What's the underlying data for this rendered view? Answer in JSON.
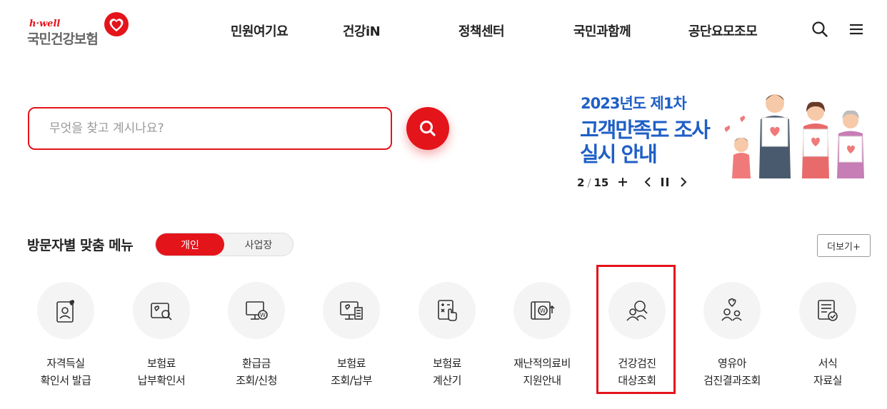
{
  "header": {
    "logo": {
      "tagline": "h·well",
      "name": "국민건강보험"
    },
    "nav": [
      {
        "label": "민원여기요"
      },
      {
        "label": "건강iN"
      },
      {
        "label": "정책센터"
      },
      {
        "label": "국민과함께"
      },
      {
        "label": "공단요모조모"
      }
    ],
    "icons": [
      "search-icon",
      "menu-icon"
    ]
  },
  "search": {
    "placeholder": "무엇을 찾고 계시나요?",
    "value": "",
    "button_icon": "search-icon"
  },
  "banner": {
    "line1": "2023년도 제1차",
    "line2": "고객만족도 조사",
    "line3": "실시 안내",
    "current_page": "2",
    "total_pages": "15",
    "pager_separator": "/",
    "controls": [
      "plus-icon",
      "prev-icon",
      "pause-icon",
      "next-icon"
    ]
  },
  "menu_section": {
    "title": "방문자별 맞춤 메뉴",
    "toggle": {
      "active": "개인",
      "inactive": "사업장"
    },
    "more_label": "더보기+",
    "items": [
      {
        "line1": "자격득실",
        "line2": "확인서 발급",
        "icon": "id-card-heart-icon"
      },
      {
        "line1": "보험료",
        "line2": "납부확인서",
        "icon": "document-search-icon"
      },
      {
        "line1": "환급금",
        "line2": "조회/신청",
        "icon": "monitor-won-icon"
      },
      {
        "line1": "보험료",
        "line2": "조회/납부",
        "icon": "monitor-receipt-icon"
      },
      {
        "line1": "보험료",
        "line2": "계산기",
        "icon": "calculator-hand-icon"
      },
      {
        "line1": "재난적의료비",
        "line2": "지원안내",
        "icon": "wallet-won-icon"
      },
      {
        "line1": "건강검진",
        "line2": "대상조회",
        "icon": "people-search-icon"
      },
      {
        "line1": "영유아",
        "line2": "검진결과조회",
        "icon": "family-heart-icon"
      },
      {
        "line1": "서식",
        "line2": "자료실",
        "icon": "form-check-icon"
      }
    ],
    "highlighted_item": "건강검진 대상조회"
  },
  "colors": {
    "brand_red": "#e4141b",
    "banner_blue": "#1f5fc6",
    "icon_circle": "#f4f4f4",
    "text_dark": "#222222"
  }
}
